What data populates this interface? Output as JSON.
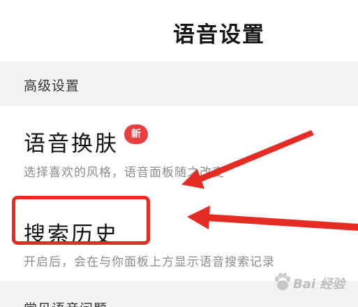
{
  "header": {
    "title": "语音设置"
  },
  "sections": {
    "advanced": {
      "label": "高级设置"
    },
    "faq": {
      "label": "常见语音问题"
    }
  },
  "settings": {
    "skin": {
      "title": "语音换肤",
      "badge": "新",
      "description": "选择喜欢的风格，语音面板随之改变"
    },
    "history": {
      "title": "搜索历史",
      "description": "开启后，会在与你面板上方显示语音搜索记录"
    }
  },
  "annotations": {
    "highlight_color": "#e42b24",
    "arrow_color": "#e42b24"
  },
  "watermark": {
    "text": "Bai 经验",
    "icon": "baidu-paw-icon"
  },
  "colors": {
    "section_bg": "#f3f3f3",
    "badge_bg": "#e8403f",
    "description_text": "#8c8c8c"
  }
}
